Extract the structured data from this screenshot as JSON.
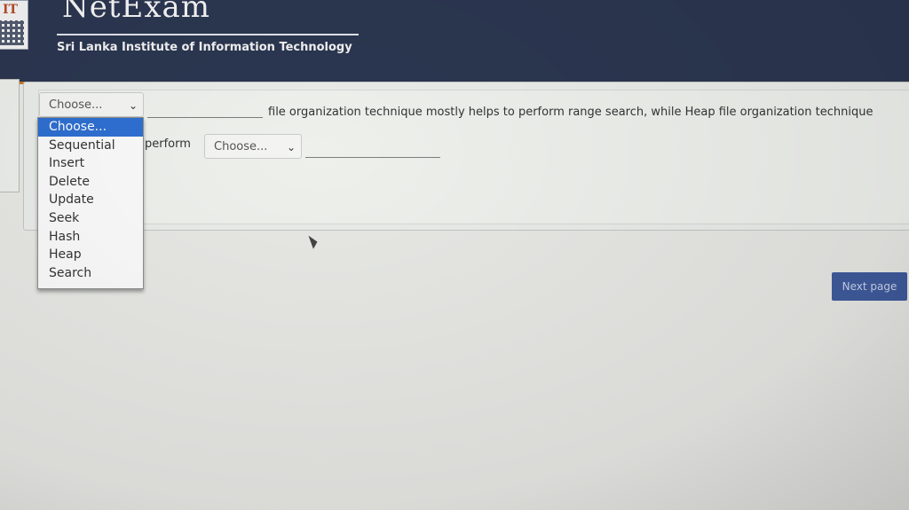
{
  "header": {
    "brand": "NetExam",
    "subtitle": "Sri Lanka Institute of Information Technology",
    "logo_text": "IT"
  },
  "question": {
    "select1_value": "Choose...",
    "text_part1": "file organization technique mostly helps to perform range search, while  Heap file organization technique",
    "text_part2": "perform",
    "select2_value": "Choose..."
  },
  "dropdown": {
    "options": [
      "Choose...",
      "Sequential",
      "Insert",
      "Delete",
      "Update",
      "Seek",
      "Hash",
      "Heap",
      "Search"
    ],
    "selected_index": 0
  },
  "footer": {
    "next_label": "Next page"
  },
  "colors": {
    "header_bg": "#2b3650",
    "accent_orange": "#c9772e",
    "selection_blue": "#2f6fd1",
    "button_blue": "#3f5a9c"
  }
}
